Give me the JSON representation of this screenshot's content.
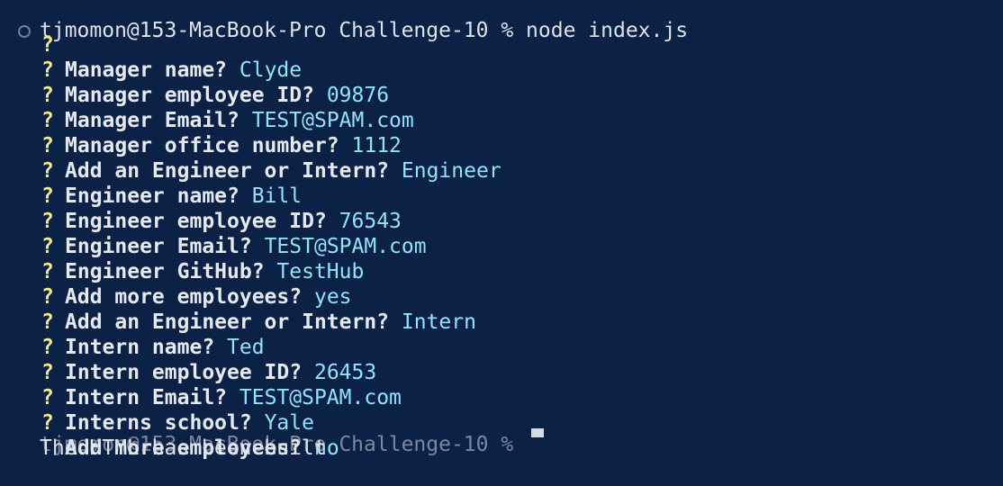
{
  "terminal": {
    "command_line": "tjmomon@153-MacBook-Pro Challenge-10 % node index.js",
    "prompt_symbol": "?",
    "prompts": [
      {
        "question": "Manager name?",
        "answer": "Clyde"
      },
      {
        "question": "Manager employee ID?",
        "answer": "09876"
      },
      {
        "question": "Manager Email?",
        "answer": "TEST@SPAM.com"
      },
      {
        "question": "Manager office number?",
        "answer": "1112"
      },
      {
        "question": "Add an Engineer or Intern?",
        "answer": "Engineer"
      },
      {
        "question": "Engineer name?",
        "answer": "Bill"
      },
      {
        "question": "Engineer employee ID?",
        "answer": "76543"
      },
      {
        "question": "Engineer Email?",
        "answer": "TEST@SPAM.com"
      },
      {
        "question": "Engineer GitHub?",
        "answer": "TestHub"
      },
      {
        "question": "Add more employees?",
        "answer": "yes"
      },
      {
        "question": "Add an Engineer or Intern?",
        "answer": "Intern"
      },
      {
        "question": "Intern name?",
        "answer": "Ted"
      },
      {
        "question": "Intern employee ID?",
        "answer": "26453"
      },
      {
        "question": "Intern Email?",
        "answer": "TEST@SPAM.com"
      },
      {
        "question": "Interns school?",
        "answer": "Yale"
      },
      {
        "question": "Add more employees?",
        "answer": "no"
      }
    ],
    "output_message": "The HTML has been built",
    "next_prompt": "tjmomon@153-MacBook-Pro Challenge-10 %"
  },
  "colors": {
    "background": "#0b2146",
    "prompt_symbol": "#f2e88a",
    "question_text": "#e6e9f0",
    "answer_text": "#92e3f5",
    "output_text": "#dfe3ea"
  }
}
